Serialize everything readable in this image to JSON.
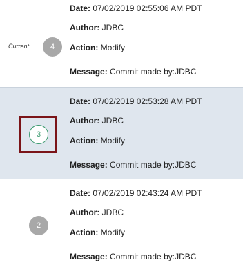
{
  "commits": [
    {
      "version": "4",
      "current_label": "Current",
      "date_label": "Date:",
      "date": "07/02/2019 02:55:06 AM PDT",
      "author_label": "Author:",
      "author": "JDBC",
      "action_label": "Action:",
      "action": "Modify",
      "message_label": "Message:",
      "message": "Commit made by:JDBC"
    },
    {
      "version": "3",
      "date_label": "Date:",
      "date": "07/02/2019 02:53:28 AM PDT",
      "author_label": "Author:",
      "author": "JDBC",
      "action_label": "Action:",
      "action": "Modify",
      "message_label": "Message:",
      "message": "Commit made by:JDBC"
    },
    {
      "version": "2",
      "date_label": "Date:",
      "date": "07/02/2019 02:43:24 AM PDT",
      "author_label": "Author:",
      "author": "JDBC",
      "action_label": "Action:",
      "action": "Modify",
      "message_label": "Message:",
      "message": "Commit made by:JDBC"
    }
  ],
  "colors": {
    "selected_row_bg": "#dfe6ee",
    "badge_grey": "#a8a8a8",
    "badge_selected_outline": "#3a9a6e",
    "selection_box": "#7b1418"
  }
}
